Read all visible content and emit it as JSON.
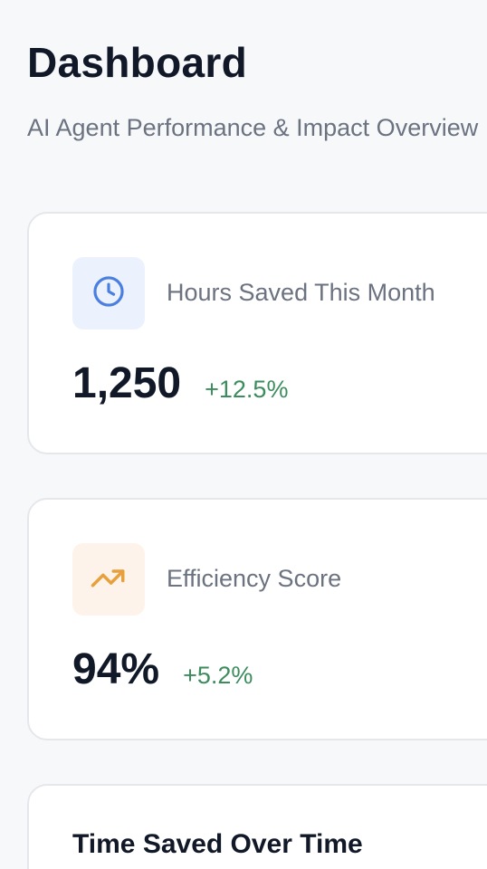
{
  "header": {
    "title": "Dashboard",
    "subtitle": "AI Agent Performance & Impact Overview"
  },
  "metrics": [
    {
      "label": "Hours Saved This Month",
      "value": "1,250",
      "delta": "+12.5%",
      "icon": "clock-icon",
      "accent": "#4a7fe0"
    },
    {
      "label": "Efficiency Score",
      "value": "94%",
      "delta": "+5.2%",
      "icon": "trending-up-icon",
      "accent": "#e8a03c"
    }
  ],
  "chart_card": {
    "title": "Time Saved Over Time"
  },
  "colors": {
    "background": "#f7f8fa",
    "card": "#ffffff",
    "positive": "#3c8c5d",
    "muted_text": "#6b7280"
  }
}
